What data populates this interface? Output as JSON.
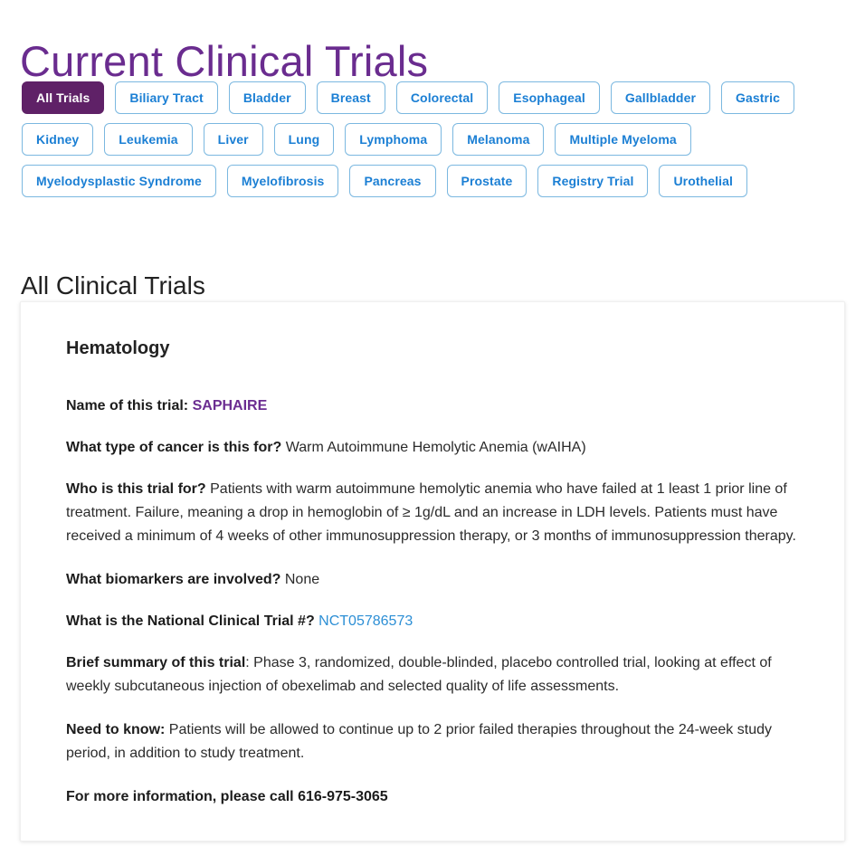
{
  "header": {
    "title": "Current Clinical Trials"
  },
  "filters": {
    "items": [
      {
        "label": "All Trials",
        "active": true
      },
      {
        "label": "Biliary Tract",
        "active": false
      },
      {
        "label": "Bladder",
        "active": false
      },
      {
        "label": "Breast",
        "active": false
      },
      {
        "label": "Colorectal",
        "active": false
      },
      {
        "label": "Esophageal",
        "active": false
      },
      {
        "label": "Gallbladder",
        "active": false
      },
      {
        "label": "Gastric",
        "active": false
      },
      {
        "label": "Kidney",
        "active": false
      },
      {
        "label": "Leukemia",
        "active": false
      },
      {
        "label": "Liver",
        "active": false
      },
      {
        "label": "Lung",
        "active": false
      },
      {
        "label": "Lymphoma",
        "active": false
      },
      {
        "label": "Melanoma",
        "active": false
      },
      {
        "label": "Multiple Myeloma",
        "active": false
      },
      {
        "label": "Myelodysplastic Syndrome",
        "active": false
      },
      {
        "label": "Myelofibrosis",
        "active": false
      },
      {
        "label": "Pancreas",
        "active": false
      },
      {
        "label": "Prostate",
        "active": false
      },
      {
        "label": "Registry Trial",
        "active": false
      },
      {
        "label": "Urothelial",
        "active": false
      }
    ]
  },
  "section": {
    "heading": "All Clinical Trials"
  },
  "trial": {
    "category": "Hematology",
    "name_label": "Name of this trial:",
    "name_value": "SAPHAIRE",
    "cancer_type_label": "What type of cancer is this for?",
    "cancer_type_value": "Warm Autoimmune Hemolytic Anemia (wAIHA)",
    "who_label": "Who is this trial for?",
    "who_value": "Patients with warm autoimmune hemolytic anemia who have failed at 1 least 1 prior line of treatment. Failure, meaning a drop in hemoglobin of ≥ 1g/dL and an increase in LDH levels.  Patients must have received a minimum of 4 weeks of other immunosuppression therapy, or 3 months of immunosuppression therapy.",
    "biomarkers_label": "What biomarkers are involved?",
    "biomarkers_value": "None",
    "nct_label": "What is the National Clinical Trial #?",
    "nct_value": "NCT05786573",
    "summary_label": "Brief summary of this trial",
    "summary_value": ": Phase 3, randomized, double-blinded, placebo controlled trial, looking at effect of weekly subcutaneous injection of obexelimab and selected quality of life assessments.",
    "need_to_know_label": "Need to know:",
    "need_to_know_value": "Patients will be allowed to continue up to 2 prior failed therapies throughout the 24-week study period, in addition to study treatment.",
    "contact_line": "For more information, please call 616-975-3065"
  },
  "colors": {
    "brand_purple": "#6a2c8f",
    "active_chip": "#5f2167",
    "chip_blue": "#1b7fd4",
    "chip_border": "#7bb8e0",
    "link_blue": "#2d8fd5",
    "link_purple": "#6b2d91"
  }
}
